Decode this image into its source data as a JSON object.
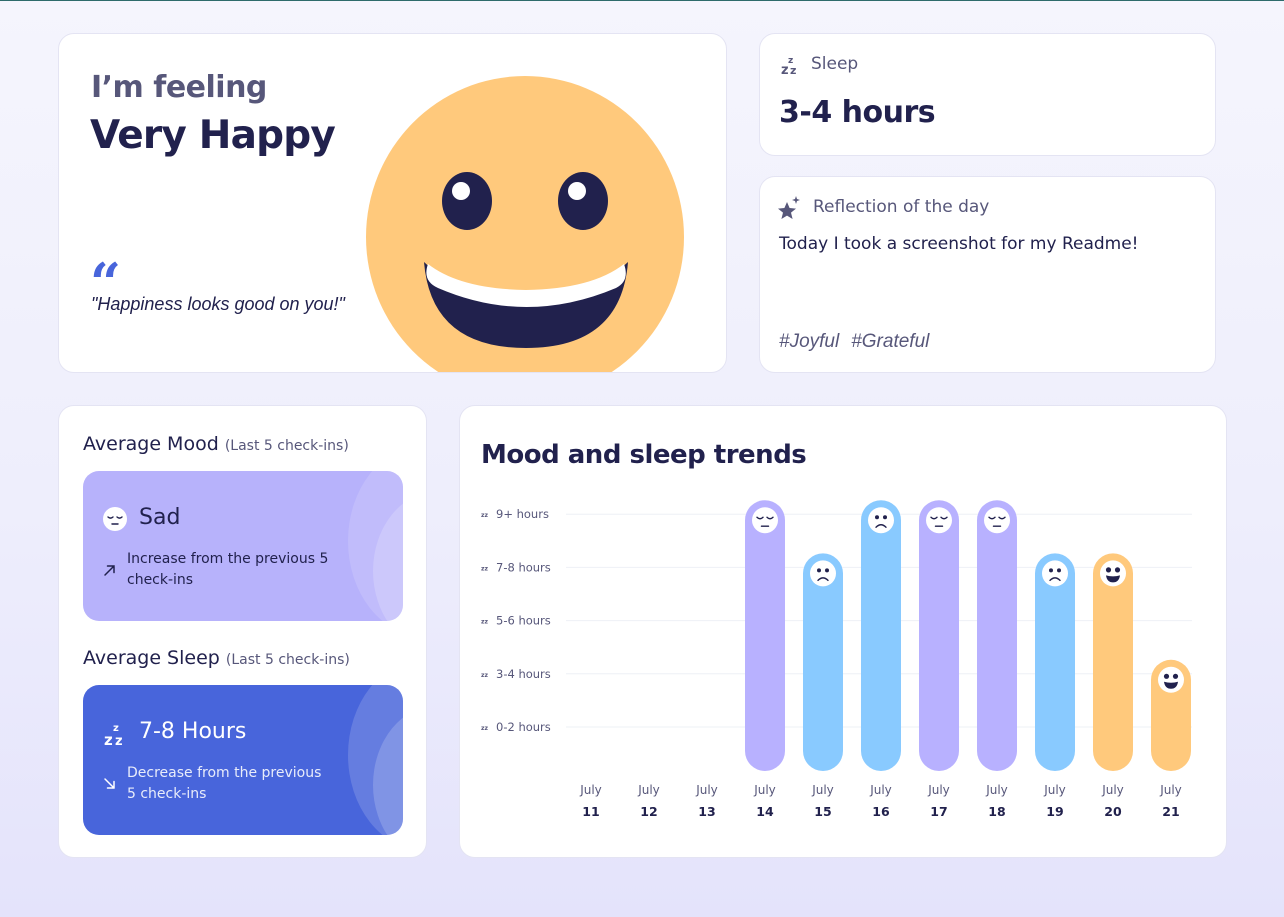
{
  "feeling": {
    "prefix": "I’m feeling",
    "mood": "Very Happy",
    "quote": "\"Happiness looks good on you!\""
  },
  "sleep_card": {
    "label": "Sleep",
    "value": "3-4 hours"
  },
  "reflection_card": {
    "label": "Reflection of the day",
    "text": "Today I took a screenshot for my Readme!",
    "tags": [
      "#Joyful",
      "#Grateful"
    ]
  },
  "average_mood": {
    "heading": "Average Mood",
    "subheading": "(Last 5 check-ins)",
    "value": "Sad",
    "note": "Increase from the previous 5 check-ins"
  },
  "average_sleep": {
    "heading": "Average Sleep",
    "subheading": "(Last 5 check-ins)",
    "value": "7-8 Hours",
    "note": "Decrease from the previous 5 check-ins"
  },
  "trends": {
    "title": "Mood and sleep trends"
  },
  "colors": {
    "very_happy": "#ffc97c",
    "neutral": "#89caff",
    "sad": "#b8b1ff",
    "accent_blue": "#4865db",
    "text_dark": "#21214d",
    "text_muted": "#57577a"
  },
  "chart_data": {
    "type": "bar",
    "ylabels": [
      "0-2 hours",
      "3-4 hours",
      "5-6 hours",
      "7-8 hours",
      "9+ hours"
    ],
    "month_labels": [
      "July",
      "July",
      "July",
      "July",
      "July",
      "July",
      "July",
      "July",
      "July",
      "July",
      "July"
    ],
    "day_labels": [
      "11",
      "12",
      "13",
      "14",
      "15",
      "16",
      "17",
      "18",
      "19",
      "20",
      "21"
    ],
    "sleep_level": [
      null,
      null,
      null,
      4,
      3,
      4,
      4,
      4,
      3,
      3,
      1
    ],
    "mood": [
      null,
      null,
      null,
      "sad",
      "neutral",
      "neutral",
      "sad",
      "sad",
      "neutral",
      "very_happy",
      "very_happy"
    ],
    "face": [
      null,
      null,
      null,
      "tired",
      "frown",
      "frown",
      "tired",
      "tired",
      "frown",
      "smile",
      "smile"
    ]
  }
}
